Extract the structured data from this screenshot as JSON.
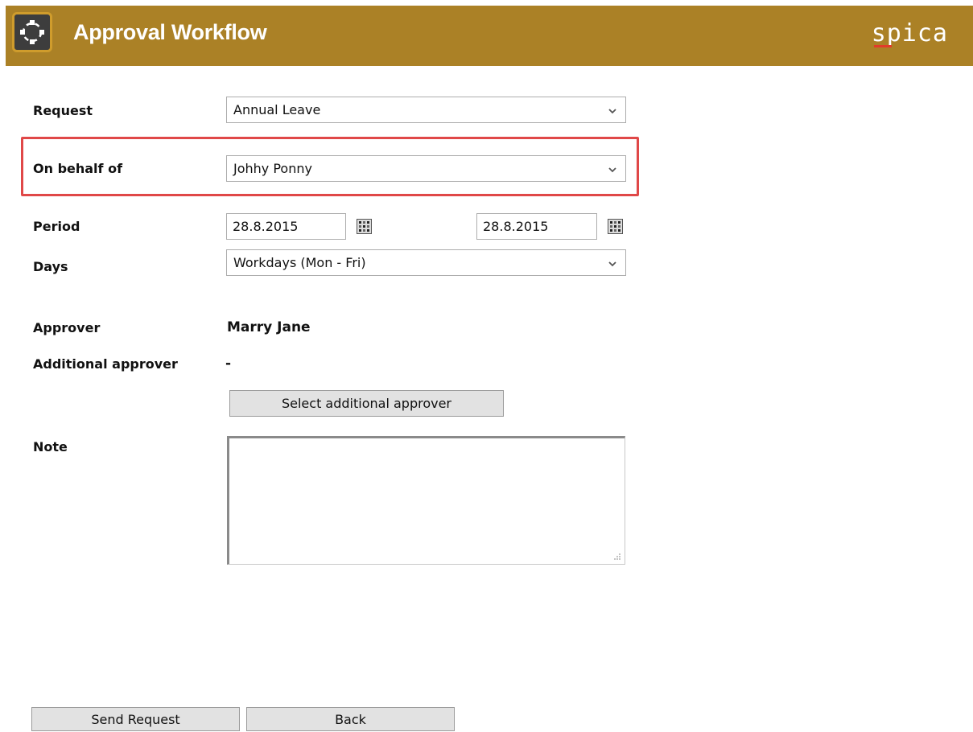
{
  "header": {
    "title": "Approval Workflow",
    "brand": "spica",
    "background_color": "#ab8126",
    "icon": "app-logo-icon"
  },
  "form": {
    "request": {
      "label": "Request",
      "value": "Annual Leave"
    },
    "on_behalf_of": {
      "label": "On behalf of",
      "value": "Johhy Ponny",
      "highlight_color": "#e04848"
    },
    "period": {
      "label": "Period",
      "from": "28.8.2015",
      "to": "28.8.2015",
      "icon": "calendar-icon"
    },
    "days": {
      "label": "Days",
      "value": "Workdays (Mon - Fri)"
    },
    "approver": {
      "label": "Approver",
      "value": "Marry Jane"
    },
    "additional_approver": {
      "label": "Additional approver",
      "value": "-"
    },
    "select_additional_button": "Select additional approver",
    "note": {
      "label": "Note",
      "value": ""
    }
  },
  "actions": {
    "send_label": "Send Request",
    "back_label": "Back"
  }
}
